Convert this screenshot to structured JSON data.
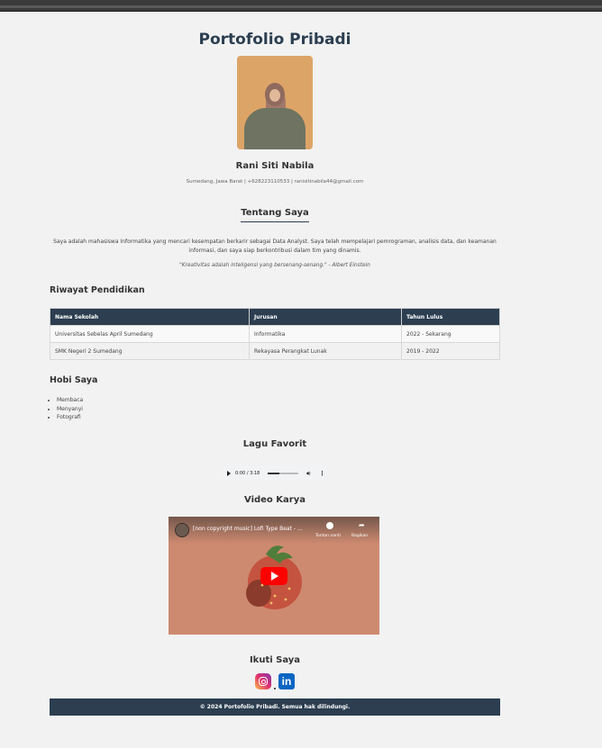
{
  "page_title": "Portofolio Pribadi",
  "profile": {
    "name": "Rani Siti Nabila",
    "contact": "Sumedang, Jawa Barat | +628223110533 | ranisitinabila44@gmail.com"
  },
  "about": {
    "title": "Tentang Saya",
    "text": "Saya adalah mahasiswa Informatika yang mencari kesempatan berkarir sebagai Data Analyst. Saya telah mempelajari pemrograman, analisis data, dan keamanan informasi, dan saya siap berkontribusi dalam tim yang dinamis.",
    "quote": "\"Kreativitas adalah inteligensi yang bersenang-senang.\" - Albert Einstein"
  },
  "education": {
    "title": "Riwayat Pendidikan",
    "headers": [
      "Nama Sekolah",
      "Jurusan",
      "Tahun Lulus"
    ],
    "rows": [
      [
        "Universitas Sebelas April Sumedang",
        "Informatika",
        "2022 - Sekarang"
      ],
      [
        "SMK Negeri 2 Sumedang",
        "Rekayasa Perangkat Lunak",
        "2019 - 2022"
      ]
    ]
  },
  "hobbies": {
    "title": "Hobi Saya",
    "items": [
      "Membaca",
      "Menyanyi",
      "Fotografi"
    ]
  },
  "music": {
    "title": "Lagu Favorit",
    "time": "0:00 / 3:18",
    "progress": 0.38
  },
  "video": {
    "title": "Video Karya",
    "video_title": "[non copyright music] Lofi Type Beat - ...",
    "watch_later": "Tonton nanti",
    "share": "Bagikan"
  },
  "social": {
    "title": "Ikuti Saya"
  },
  "footer": "© 2024 Portofolio Pribadi. Semua hak dilindungi."
}
